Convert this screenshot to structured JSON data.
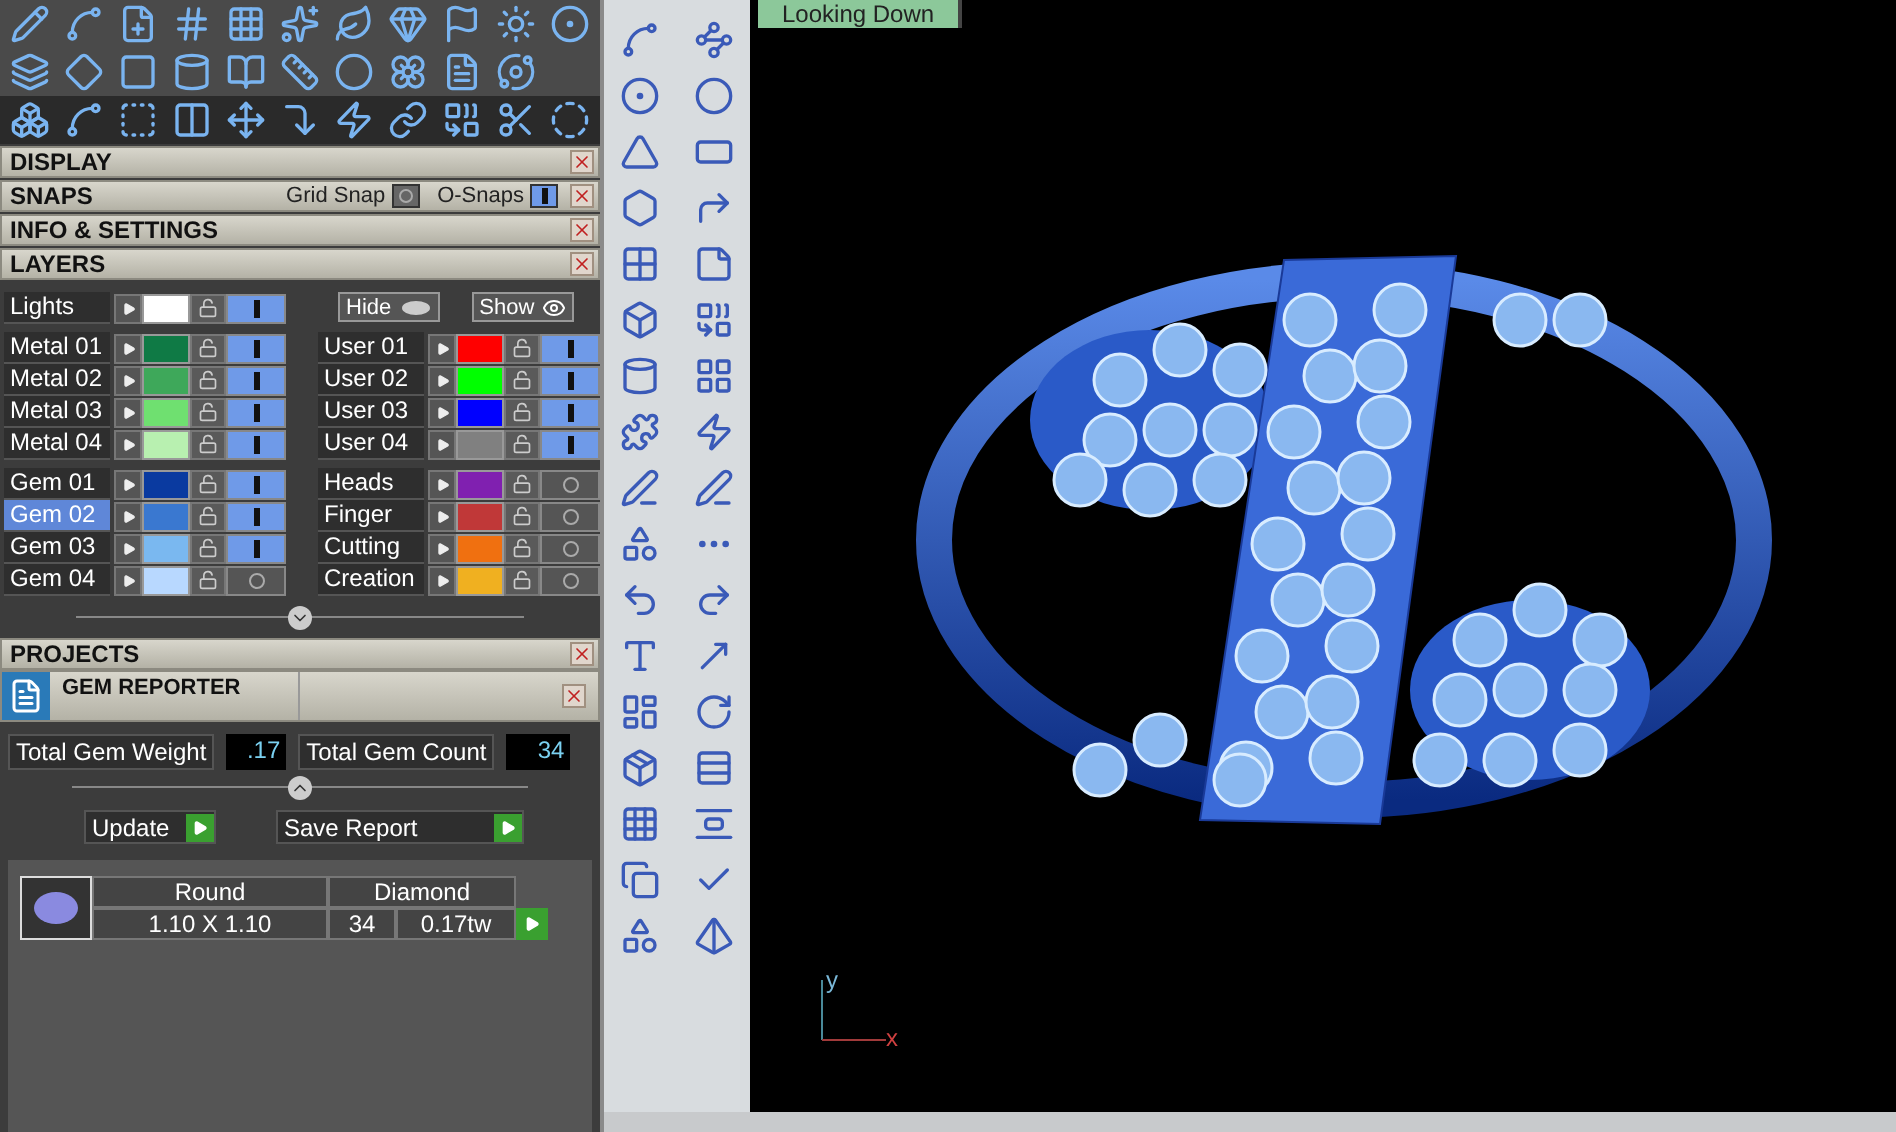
{
  "sections": [
    {
      "title": "DISPLAY"
    },
    {
      "title": "SNAPS",
      "toggles": [
        {
          "label": "Grid Snap",
          "on": false
        },
        {
          "label": "O-Snaps",
          "on": true
        }
      ]
    },
    {
      "title": "INFO & SETTINGS"
    },
    {
      "title": "LAYERS"
    }
  ],
  "layers": {
    "lights": {
      "name": "Lights",
      "color": "#ffffff",
      "visible": true
    },
    "hide_button": "Hide",
    "show_button": "Show",
    "blocks": [
      {
        "left": [
          {
            "name": "Metal 01",
            "color": "#0f7a45",
            "visible": true,
            "selected": false
          },
          {
            "name": "Metal 02",
            "color": "#3ea85a",
            "visible": true,
            "selected": false
          },
          {
            "name": "Metal 03",
            "color": "#6fe070",
            "visible": true,
            "selected": false
          },
          {
            "name": "Metal 04",
            "color": "#b8f0b0",
            "visible": true,
            "selected": false
          }
        ],
        "right": [
          {
            "name": "User 01",
            "color": "#ff0000",
            "visible": true,
            "selected": false
          },
          {
            "name": "User 02",
            "color": "#00ff00",
            "visible": true,
            "selected": false
          },
          {
            "name": "User 03",
            "color": "#0000ff",
            "visible": true,
            "selected": false
          },
          {
            "name": "User 04",
            "color": "#808080",
            "visible": true,
            "selected": false
          }
        ]
      },
      {
        "left": [
          {
            "name": "Gem 01",
            "color": "#0a3aa0",
            "visible": true,
            "selected": false
          },
          {
            "name": "Gem 02",
            "color": "#3a78d0",
            "visible": true,
            "selected": true
          },
          {
            "name": "Gem 03",
            "color": "#7ab8f0",
            "visible": true,
            "selected": false
          },
          {
            "name": "Gem 04",
            "color": "#b8d8ff",
            "visible": false,
            "selected": false
          }
        ],
        "right": [
          {
            "name": "Heads",
            "color": "#8020b0",
            "visible": false,
            "selected": false
          },
          {
            "name": "Finger",
            "color": "#c03838",
            "visible": false,
            "selected": false
          },
          {
            "name": "Cutting",
            "color": "#f07010",
            "visible": false,
            "selected": false
          },
          {
            "name": "Creation",
            "color": "#f0b020",
            "visible": false,
            "selected": false
          }
        ]
      }
    ]
  },
  "projects": {
    "title": "PROJECTS"
  },
  "gem_reporter": {
    "title": "GEM REPORTER",
    "total_weight_label": "Total Gem Weight",
    "total_weight": ".17",
    "total_count_label": "Total Gem Count",
    "total_count": "34",
    "update_button": "Update",
    "save_button": "Save Report",
    "gems": [
      {
        "shape": "Round",
        "size": "1.10 X 1.10",
        "material": "Diamond",
        "count": "34",
        "weight": "0.17tw"
      }
    ]
  },
  "viewport": {
    "view_tab": "Looking Down",
    "axes": {
      "y": "y",
      "x": "x"
    }
  }
}
